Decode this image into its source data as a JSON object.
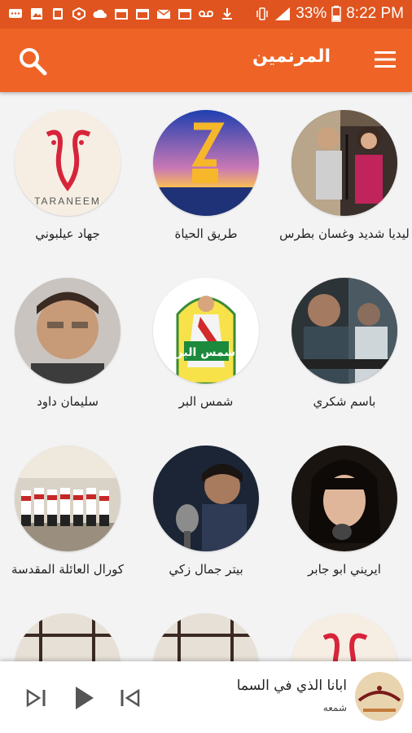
{
  "status_bar": {
    "battery": "33%",
    "time": "8:22 PM",
    "icons": [
      "message-icon",
      "image-icon",
      "screenshot-icon",
      "hexagon-icon",
      "cloud-icon",
      "calendar-icon",
      "calendar-icon",
      "mail-icon",
      "calendar-icon",
      "voicemail-icon",
      "download-icon",
      "vibrate-icon",
      "signal-icon",
      "battery-icon"
    ]
  },
  "app_bar": {
    "title": "المرنمين",
    "menu_icon": "hamburger-menu-icon",
    "search_icon": "search-icon",
    "background": "#ef6426"
  },
  "artists": [
    {
      "name": "ليديا شديد وغسان بطرس"
    },
    {
      "name": "طريق الحياة"
    },
    {
      "name": "جهاد عيلبوني",
      "logo_text": "TARANEEM"
    },
    {
      "name": "باسم شكري"
    },
    {
      "name": "شمس البر",
      "art_text": "شمس البر"
    },
    {
      "name": "سليمان داود"
    },
    {
      "name": "ايريني ابو جابر"
    },
    {
      "name": "بيتر جمال زكي"
    },
    {
      "name": "كورال العائلة المقدسة"
    },
    {
      "name": ""
    },
    {
      "name": ""
    },
    {
      "name": ""
    }
  ],
  "player": {
    "song_title": "ابانا الذي في السما",
    "artist": "شمعه",
    "controls": [
      "skip-next-icon",
      "play-icon",
      "skip-previous-icon"
    ]
  }
}
